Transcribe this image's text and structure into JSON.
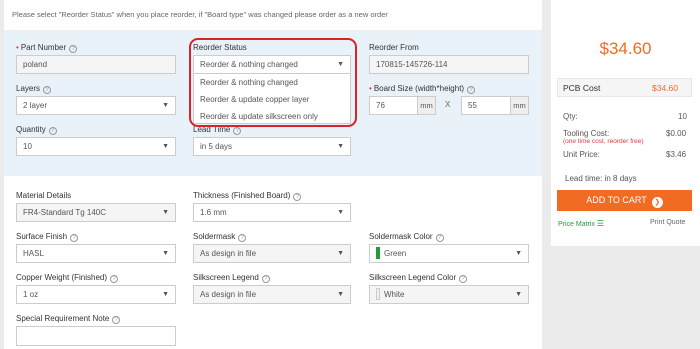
{
  "note": "Please select \"Reorder Status\" when you place reorder, if \"Board type\" was changed please order as a new order",
  "part_number": {
    "label": "Part Number",
    "value": "poland"
  },
  "reorder_status": {
    "label": "Reorder Status",
    "value": "Reorder & nothing changed",
    "options": [
      "Reorder & nothing changed",
      "Reorder & update copper layer",
      "Reorder & update silkscreen only"
    ]
  },
  "reorder_from": {
    "label": "Reorder From",
    "value": "170815-145726-114"
  },
  "layers": {
    "label": "Layers",
    "value": "2 layer"
  },
  "board_size": {
    "label": "Board Size (width*height)",
    "width": "76",
    "height": "55",
    "unit": "mm",
    "sep": "X"
  },
  "quantity": {
    "label": "Quantity",
    "value": "10"
  },
  "lead_time": {
    "label": "Lead Time",
    "value": "in 5 days"
  },
  "material": {
    "label": "Material Details",
    "value": "FR4-Standard Tg 140C"
  },
  "thickness": {
    "label": "Thickness (Finished Board)",
    "value": "1.6 mm"
  },
  "surface_finish": {
    "label": "Surface Finish",
    "value": "HASL"
  },
  "soldermask": {
    "label": "Soldermask",
    "value": "As design in file"
  },
  "soldermask_color": {
    "label": "Soldermask Color",
    "value": "Green",
    "swatch": "#1e9e3a"
  },
  "copper_weight": {
    "label": "Copper Weight (Finished)",
    "value": "1 oz"
  },
  "silkscreen": {
    "label": "Silkscreen Legend",
    "value": "As design in file"
  },
  "silkscreen_color": {
    "label": "Silkscreen Legend Color",
    "value": "White",
    "swatch": "#f0f0f0"
  },
  "special_note": {
    "label": "Special Requirement Note",
    "value": ""
  },
  "summary": {
    "price": "$34.60",
    "pcb_cost_label": "PCB Cost",
    "pcb_cost": "$34.60",
    "qty_label": "Qty:",
    "qty": "10",
    "tooling_label": "Tooling Cost:",
    "tooling_note": "(one time cost, reorder free)",
    "tooling": "$0.00",
    "unit_label": "Unit Price:",
    "unit": "$3.46",
    "lead_time": "Lead time: in 8 days",
    "cart": "ADD TO CART",
    "price_matrix": "Price Matrix",
    "print_quote": "Print Quote"
  },
  "colors": {
    "accent": "#f26b23",
    "highlight": "#d9222a",
    "link": "#1e9e3a"
  }
}
